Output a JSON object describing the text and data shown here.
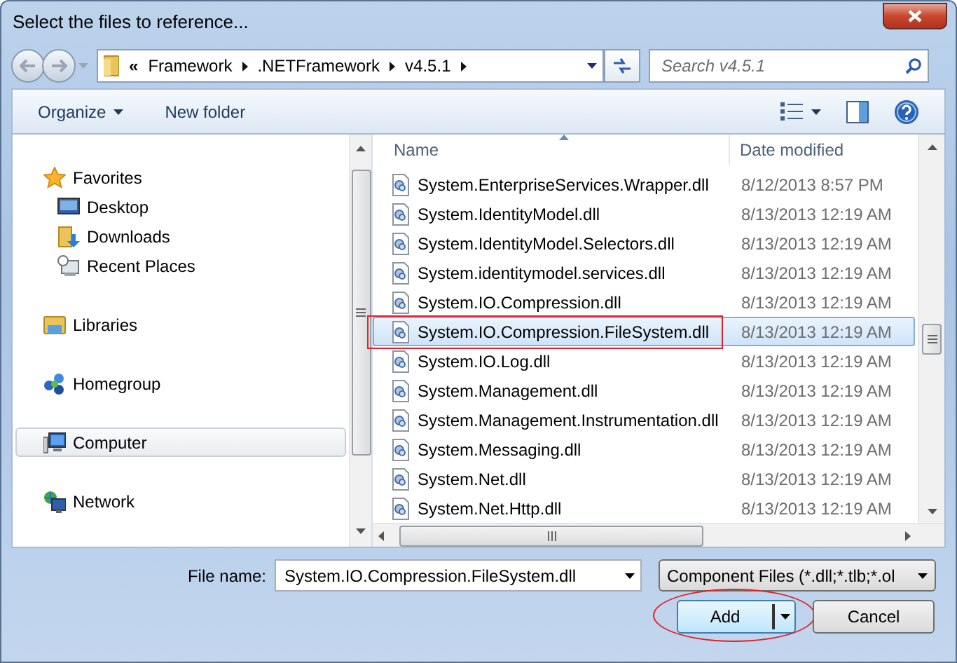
{
  "window": {
    "title": "Select the files to reference..."
  },
  "address": {
    "overflow": "«",
    "path": [
      "Framework",
      ".NETFramework",
      "v4.5.1"
    ]
  },
  "search": {
    "placeholder": "Search v4.5.1"
  },
  "toolbar": [
    {
      "label": "Organize",
      "kind": "menu"
    },
    {
      "label": "New folder",
      "kind": "plain"
    }
  ],
  "navigation": [
    {
      "label": "Favorites",
      "kind": "star",
      "selected": false,
      "children": [
        {
          "label": "Desktop",
          "kind": "desktop",
          "selected": false
        },
        {
          "label": "Downloads",
          "kind": "downloads",
          "selected": false
        },
        {
          "label": "Recent Places",
          "kind": "recent",
          "selected": false
        }
      ]
    },
    {
      "label": "Libraries",
      "kind": "library",
      "selected": false
    },
    {
      "label": "Homegroup",
      "kind": "homegroup",
      "selected": false
    },
    {
      "label": "Computer",
      "kind": "computer",
      "selected": true
    },
    {
      "label": "Network",
      "kind": "network",
      "selected": false
    }
  ],
  "file_list": {
    "columns": [
      "Name",
      "Date modified"
    ],
    "rows": [
      {
        "name": "System.EnterpriseServices.Wrapper.dll",
        "date": "8/12/2013 8:57 PM",
        "selected": false,
        "outlined": false
      },
      {
        "name": "System.IdentityModel.dll",
        "date": "8/13/2013 12:19 AM",
        "selected": false,
        "outlined": false
      },
      {
        "name": "System.IdentityModel.Selectors.dll",
        "date": "8/13/2013 12:19 AM",
        "selected": false,
        "outlined": false
      },
      {
        "name": "System.identitymodel.services.dll",
        "date": "8/13/2013 12:19 AM",
        "selected": false,
        "outlined": false
      },
      {
        "name": "System.IO.Compression.dll",
        "date": "8/13/2013 12:19 AM",
        "selected": false,
        "outlined": false
      },
      {
        "name": "System.IO.Compression.FileSystem.dll",
        "date": "8/13/2013 12:19 AM",
        "selected": true,
        "outlined": true
      },
      {
        "name": "System.IO.Log.dll",
        "date": "8/13/2013 12:19 AM",
        "selected": false,
        "outlined": false
      },
      {
        "name": "System.Management.dll",
        "date": "8/13/2013 12:19 AM",
        "selected": false,
        "outlined": false
      },
      {
        "name": "System.Management.Instrumentation.dll",
        "date": "8/13/2013 12:19 AM",
        "selected": false,
        "outlined": false
      },
      {
        "name": "System.Messaging.dll",
        "date": "8/13/2013 12:19 AM",
        "selected": false,
        "outlined": false
      },
      {
        "name": "System.Net.dll",
        "date": "8/13/2013 12:19 AM",
        "selected": false,
        "outlined": false
      },
      {
        "name": "System.Net.Http.dll",
        "date": "8/13/2013 12:19 AM",
        "selected": false,
        "outlined": false
      }
    ]
  },
  "file_name": {
    "label": "File name:",
    "value": "System.IO.Compression.FileSystem.dll"
  },
  "file_type": {
    "value": "Component Files (*.dll;*.tlb;*.ol"
  },
  "buttons": [
    {
      "label": "Add",
      "kind": "split",
      "circled": true
    },
    {
      "label": "Cancel",
      "kind": "plain",
      "circled": false
    }
  ]
}
